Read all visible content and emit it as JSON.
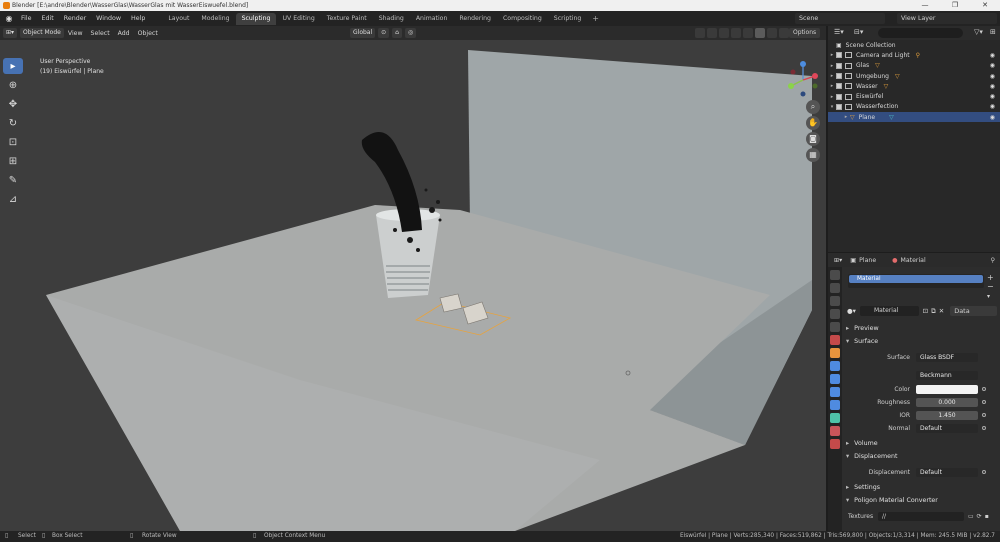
{
  "window": {
    "title": "Blender [E:\\andre\\Blender\\WasserGlas\\WasserGlas mit WasserEiswuefel.blend]",
    "controls": [
      "—",
      "❐",
      "✕"
    ]
  },
  "menubar": {
    "items": [
      "File",
      "Edit",
      "Render",
      "Window",
      "Help"
    ],
    "workspaces": [
      "Layout",
      "Modeling",
      "Sculpting",
      "UV Editing",
      "Texture Paint",
      "Shading",
      "Animation",
      "Rendering",
      "Compositing",
      "Scripting"
    ],
    "active_workspace": "Sculpting",
    "add_tab": "+",
    "scene": "Scene",
    "view_layer": "View Layer"
  },
  "viewport_header": {
    "mode": "Object Mode",
    "menus": [
      "View",
      "Select",
      "Add",
      "Object"
    ],
    "orientation": "Global",
    "options": "Options"
  },
  "viewport": {
    "perspective": "User Perspective",
    "object_info": "(19) Eiswürfel | Plane",
    "gizmo_axes": [
      "X",
      "Y",
      "Z"
    ]
  },
  "toolbar": {
    "tools": [
      "select-box",
      "cursor",
      "move",
      "rotate",
      "scale",
      "transform",
      "annotate",
      "measure"
    ],
    "active": "select-box"
  },
  "outliner": {
    "root": "Scene Collection",
    "rows": [
      {
        "label": "Camera and Light",
        "expanded": false,
        "checked": true,
        "selected": false
      },
      {
        "label": "Glas",
        "expanded": false,
        "checked": true,
        "selected": false
      },
      {
        "label": "Umgebung",
        "expanded": false,
        "checked": true,
        "selected": false
      },
      {
        "label": "Wasser",
        "expanded": false,
        "checked": true,
        "selected": false
      },
      {
        "label": "Eiswürfel",
        "expanded": false,
        "checked": true,
        "selected": false
      },
      {
        "label": "Wasserfection",
        "expanded": true,
        "checked": true,
        "selected": false
      },
      {
        "label": "Plane",
        "expanded": false,
        "checked": false,
        "selected": true
      }
    ]
  },
  "properties": {
    "object": "Plane",
    "context": "Material",
    "slot": "Material",
    "material_name": "Material",
    "link": "Data",
    "sections": {
      "preview": "Preview",
      "surface": "Surface",
      "volume": "Volume",
      "displacement": "Displacement",
      "settings": "Settings",
      "converter": "Poligon Material Converter"
    },
    "surface": {
      "surface_label": "Surface",
      "surface_value": "Glass BSDF",
      "distribution": "Beckmann",
      "color_label": "Color",
      "color_value": "#f4f4f4",
      "roughness_label": "Roughness",
      "roughness_value": "0.000",
      "ior_label": "IOR",
      "ior_value": "1.450",
      "normal_label": "Normal",
      "normal_value": "Default"
    },
    "displacement": {
      "label": "Displacement",
      "value": "Default"
    },
    "textures": {
      "label": "Textures",
      "value": "//"
    }
  },
  "statusbar": {
    "select": "Select",
    "box_select": "Box Select",
    "rotate": "Rotate View",
    "context_menu": "Object Context Menu",
    "stats": "Eiswürfel | Plane | Verts:285,340 | Faces:519,862 | Tris:569,800 | Objects:1/3,314 | Mem: 245.5 MiB | v2.82.7"
  },
  "colors": {
    "accent": "#4772b3",
    "selected_row": "#334d80",
    "object_orange": "#e8a33d"
  }
}
